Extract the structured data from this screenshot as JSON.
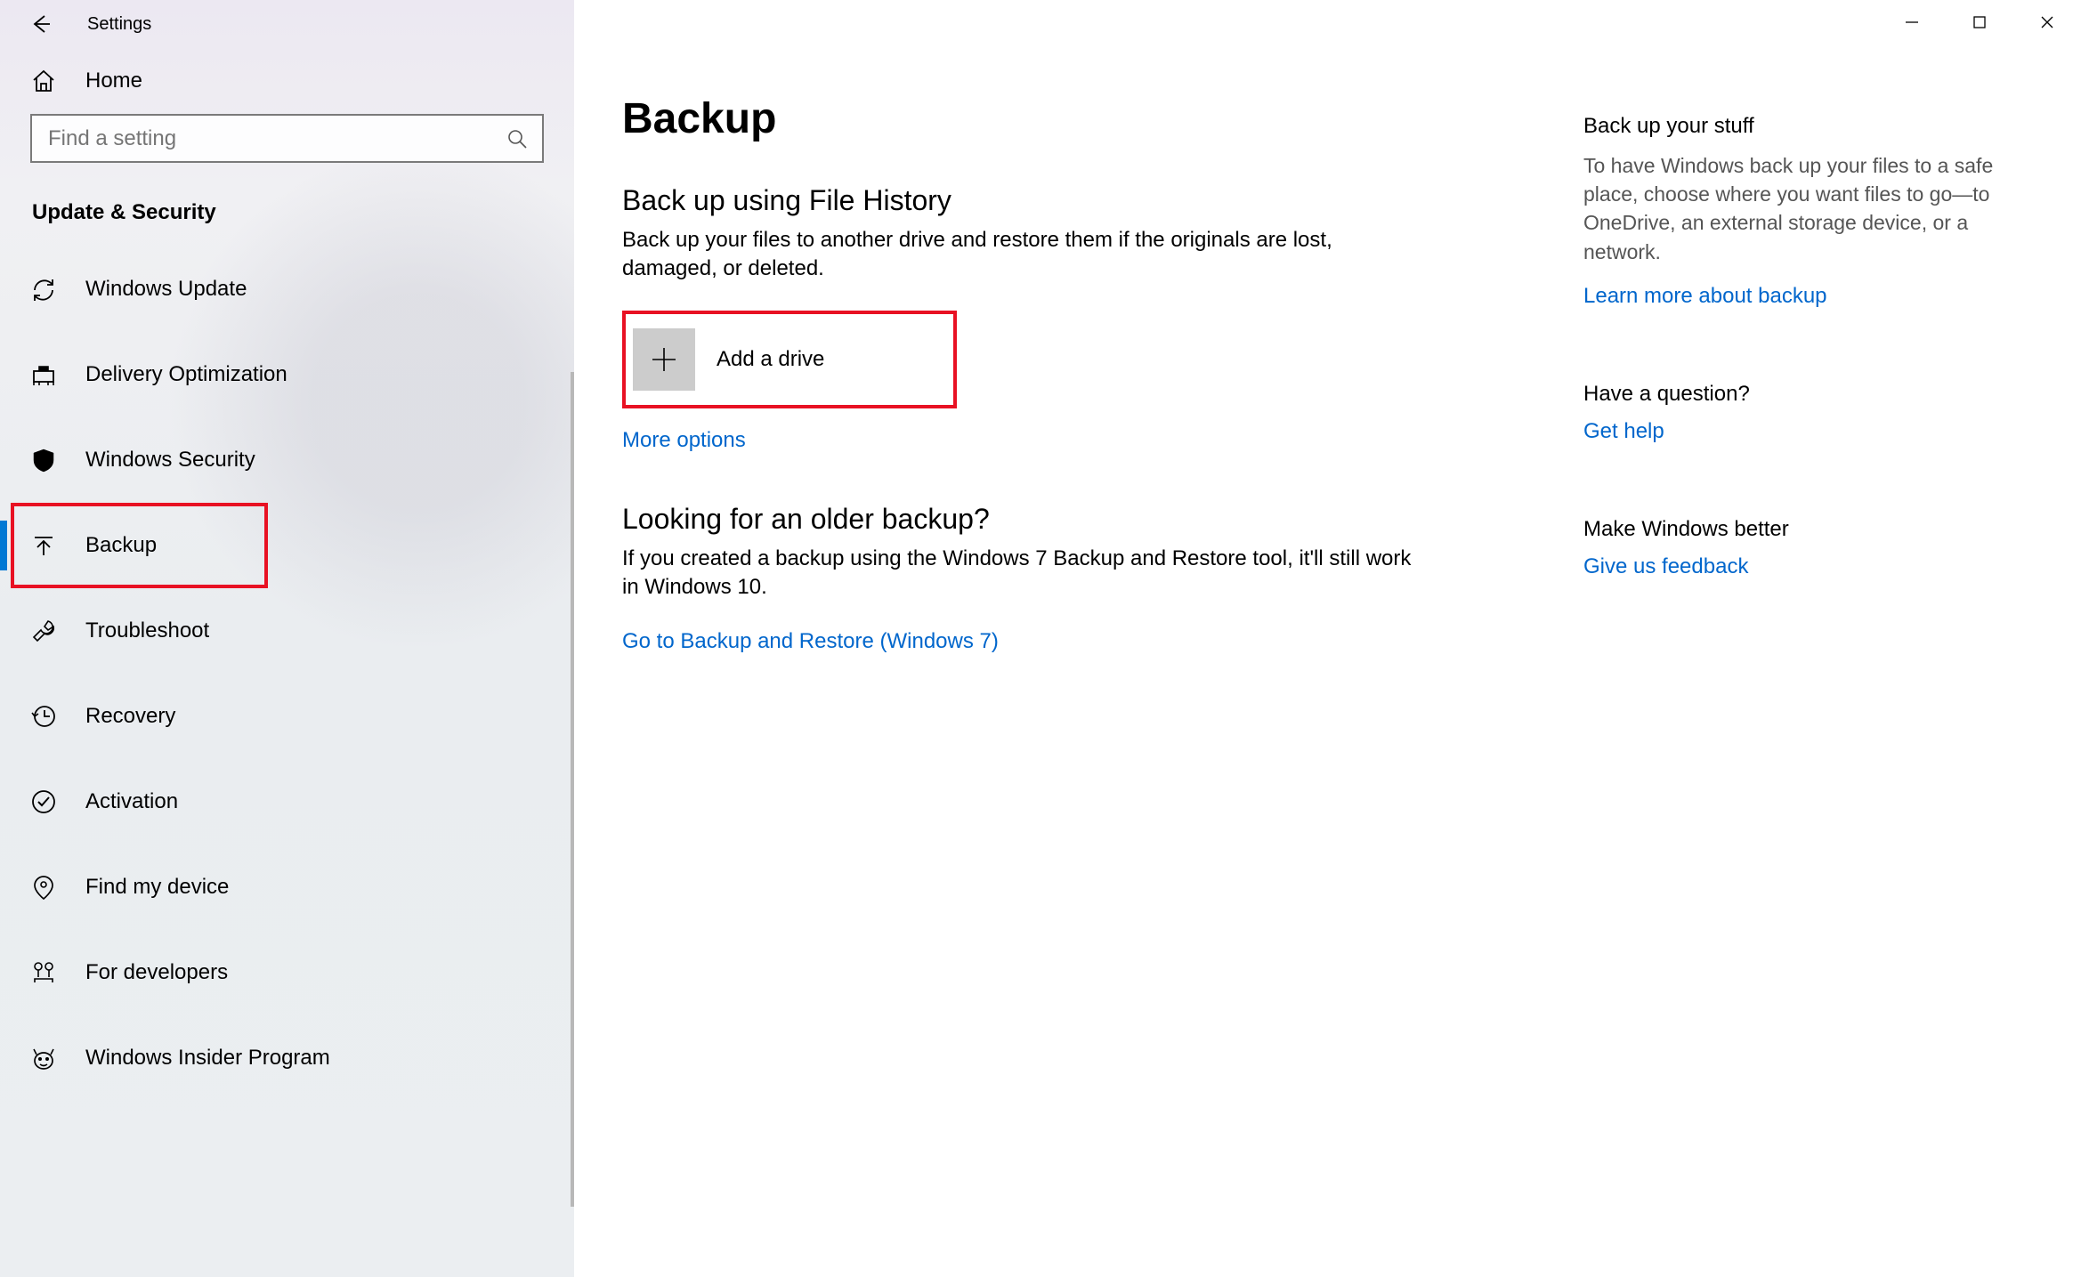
{
  "window": {
    "title": "Settings"
  },
  "sidebar": {
    "home_label": "Home",
    "search_placeholder": "Find a setting",
    "group_title": "Update & Security",
    "items": [
      {
        "label": "Windows Update",
        "icon": "sync"
      },
      {
        "label": "Delivery Optimization",
        "icon": "delivery"
      },
      {
        "label": "Windows Security",
        "icon": "shield"
      },
      {
        "label": "Backup",
        "icon": "backup",
        "active": true
      },
      {
        "label": "Troubleshoot",
        "icon": "wrench"
      },
      {
        "label": "Recovery",
        "icon": "history"
      },
      {
        "label": "Activation",
        "icon": "check-circle"
      },
      {
        "label": "Find my device",
        "icon": "location"
      },
      {
        "label": "For developers",
        "icon": "developers"
      },
      {
        "label": "Windows Insider Program",
        "icon": "insider"
      }
    ]
  },
  "main": {
    "page_title": "Backup",
    "file_history": {
      "title": "Back up using File History",
      "desc": "Back up your files to another drive and restore them if the originals are lost, damaged, or deleted.",
      "add_drive_label": "Add a drive",
      "more_options": "More options"
    },
    "older_backup": {
      "title": "Looking for an older backup?",
      "desc": "If you created a backup using the Windows 7 Backup and Restore tool, it'll still work in Windows 10.",
      "link": "Go to Backup and Restore (Windows 7)"
    }
  },
  "aside": {
    "stuff": {
      "title": "Back up your stuff",
      "desc": "To have Windows back up your files to a safe place, choose where you want files to go—to OneDrive, an external storage device, or a network.",
      "link": "Learn more about backup"
    },
    "question": {
      "title": "Have a question?",
      "link": "Get help"
    },
    "feedback": {
      "title": "Make Windows better",
      "link": "Give us feedback"
    }
  }
}
